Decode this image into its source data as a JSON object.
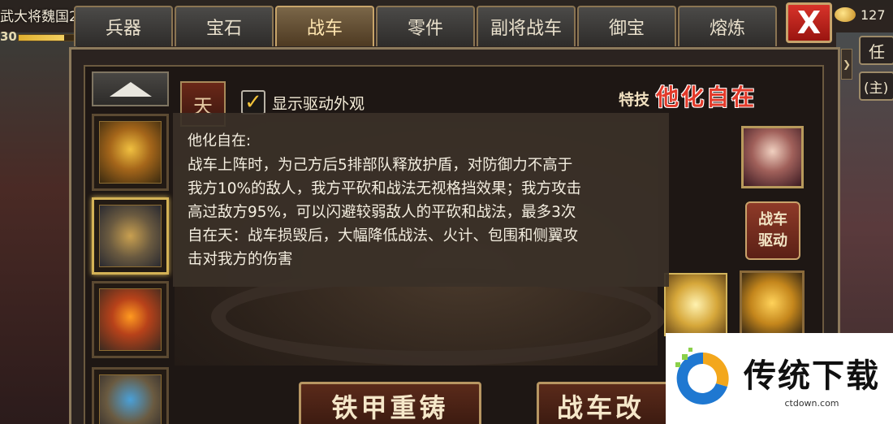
{
  "player": {
    "name": "武大将魏国2",
    "level": "30",
    "exp_progress": 0.82
  },
  "tabs": [
    {
      "label": "兵器",
      "active": false
    },
    {
      "label": "宝石",
      "active": false
    },
    {
      "label": "战车",
      "active": true
    },
    {
      "label": "零件",
      "active": false
    },
    {
      "label": "副将战车",
      "active": false
    },
    {
      "label": "御宝",
      "active": false
    },
    {
      "label": "熔炼",
      "active": false
    }
  ],
  "close_label": "X",
  "currency": {
    "value": "127",
    "icon": "coin-icon"
  },
  "side_buttons": {
    "task": "任",
    "main": "(主)"
  },
  "badge_label": "天",
  "checkbox": {
    "label": "显示驱动外观",
    "checked": true,
    "mark": "✓"
  },
  "skill": {
    "tag": "特技",
    "name": "他化自在"
  },
  "tooltip": {
    "title": "他化自在:",
    "lines": [
      "战车上阵时，为己方后5排部队释放护盾，对防御力不高于",
      "我方10%的敌人，我方平砍和战法无视格挡效果；我方攻击",
      "高过敌方95%，可以闪避较弱敌人的平砍和战法，最多3次",
      "自在天：战车损毁后，大幅降低战法、火计、包围和侧翼攻",
      "击对我方的伤害"
    ]
  },
  "drive_button": {
    "line1": "战车",
    "line2": "驱动"
  },
  "bottom_buttons": {
    "rebuild": "铁甲重铸",
    "modify": "战车改"
  },
  "watermark": {
    "title": "传统下载",
    "url": "ctdown.com"
  },
  "colors": {
    "accent_gold": "#d4b256",
    "close_red": "#d8332a",
    "skill_red": "#e23a2a"
  }
}
